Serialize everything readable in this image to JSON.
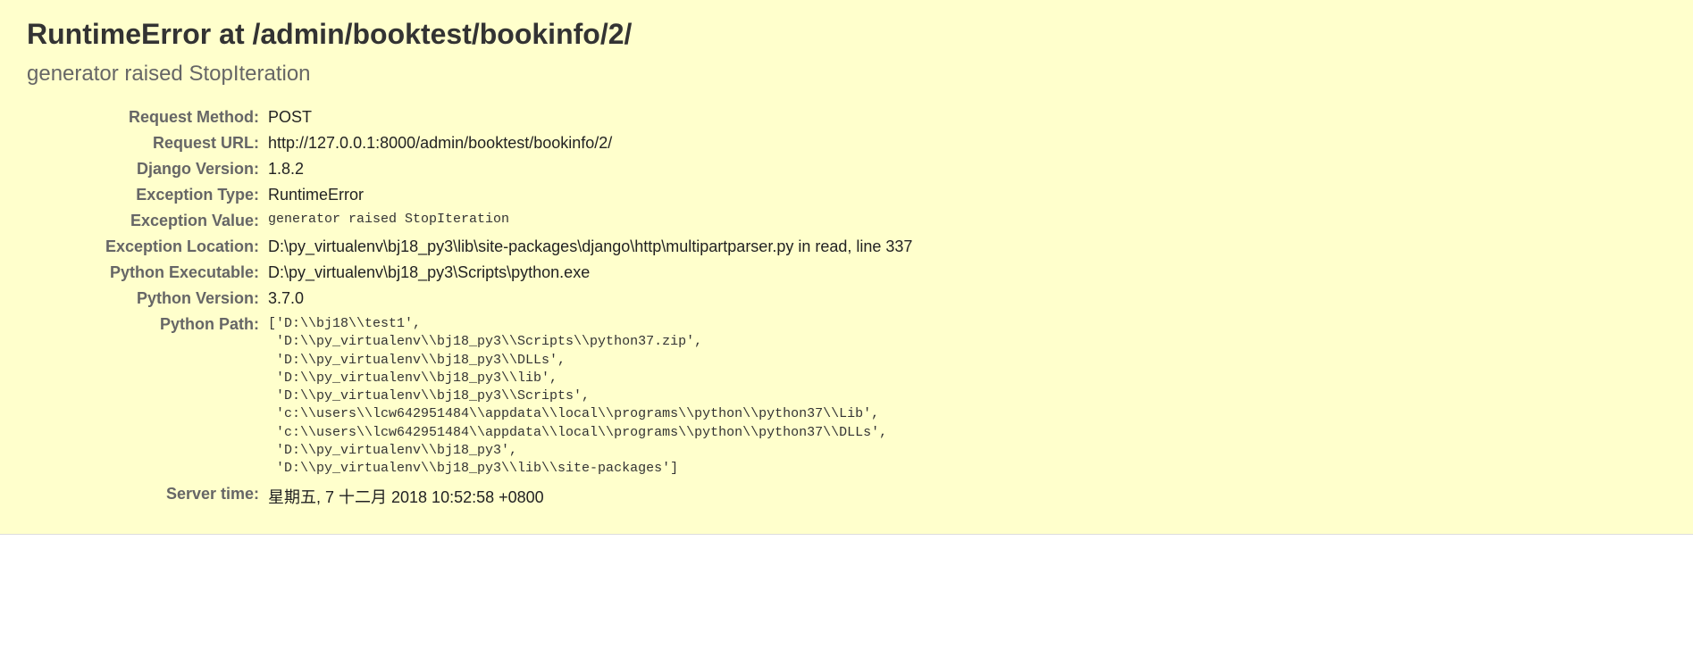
{
  "summary": {
    "title": "RuntimeError at /admin/booktest/bookinfo/2/",
    "exception_message": "generator raised StopIteration",
    "rows": {
      "request_method": {
        "label": "Request Method:",
        "value": "POST"
      },
      "request_url": {
        "label": "Request URL:",
        "value": "http://127.0.0.1:8000/admin/booktest/bookinfo/2/"
      },
      "django_version": {
        "label": "Django Version:",
        "value": "1.8.2"
      },
      "exception_type": {
        "label": "Exception Type:",
        "value": "RuntimeError"
      },
      "exception_value": {
        "label": "Exception Value:",
        "value": "generator raised StopIteration"
      },
      "exception_location": {
        "label": "Exception Location:",
        "value": "D:\\py_virtualenv\\bj18_py3\\lib\\site-packages\\django\\http\\multipartparser.py in read, line 337"
      },
      "python_executable": {
        "label": "Python Executable:",
        "value": "D:\\py_virtualenv\\bj18_py3\\Scripts\\python.exe"
      },
      "python_version": {
        "label": "Python Version:",
        "value": "3.7.0"
      },
      "python_path": {
        "label": "Python Path:",
        "value": "['D:\\\\bj18\\\\test1',\n 'D:\\\\py_virtualenv\\\\bj18_py3\\\\Scripts\\\\python37.zip',\n 'D:\\\\py_virtualenv\\\\bj18_py3\\\\DLLs',\n 'D:\\\\py_virtualenv\\\\bj18_py3\\\\lib',\n 'D:\\\\py_virtualenv\\\\bj18_py3\\\\Scripts',\n 'c:\\\\users\\\\lcw642951484\\\\appdata\\\\local\\\\programs\\\\python\\\\python37\\\\Lib',\n 'c:\\\\users\\\\lcw642951484\\\\appdata\\\\local\\\\programs\\\\python\\\\python37\\\\DLLs',\n 'D:\\\\py_virtualenv\\\\bj18_py3',\n 'D:\\\\py_virtualenv\\\\bj18_py3\\\\lib\\\\site-packages']"
      },
      "server_time": {
        "label": "Server time:",
        "value": "星期五, 7 十二月 2018 10:52:58 +0800"
      }
    }
  }
}
